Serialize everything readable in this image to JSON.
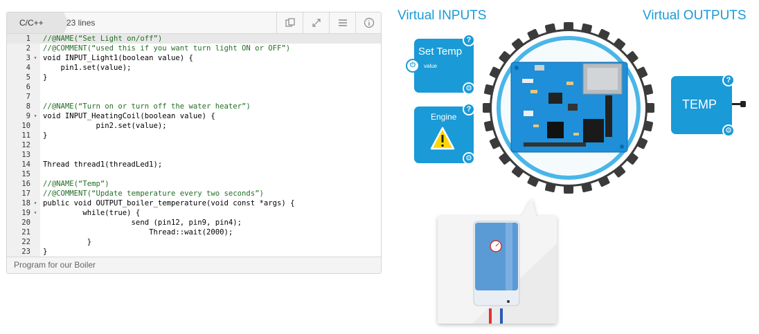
{
  "editor": {
    "language": "C/C++",
    "lines_count": "23 lines",
    "footer": "Program for our Boiler",
    "tools": [
      "copy-icon",
      "expand-icon",
      "menu-icon",
      "info-icon"
    ],
    "lines": [
      {
        "n": "1",
        "fold": "",
        "text": "//@NAME(“Set Light on/off”)",
        "cls": "t-c"
      },
      {
        "n": "2",
        "fold": "",
        "text": "//@COMMENT(“used this if you want turn light ON or OFF”)",
        "cls": "t-c"
      },
      {
        "n": "3",
        "fold": "▾",
        "text": "void INPUT_Light1(boolean value) {",
        "cls": "t-p"
      },
      {
        "n": "4",
        "fold": "",
        "text": "    pin1.set(value);",
        "cls": "t-p"
      },
      {
        "n": "5",
        "fold": "",
        "text": "}",
        "cls": "t-p"
      },
      {
        "n": "6",
        "fold": "",
        "text": "",
        "cls": "t-p"
      },
      {
        "n": "7",
        "fold": "",
        "text": "",
        "cls": "t-p"
      },
      {
        "n": "8",
        "fold": "",
        "text": "//@NAME(“Turn on or turn off the water heater”)",
        "cls": "t-c"
      },
      {
        "n": "9",
        "fold": "▾",
        "text": "void INPUT_HeatingCoil(boolean value) {",
        "cls": "t-p"
      },
      {
        "n": "10",
        "fold": "",
        "text": "            pin2.set(value);",
        "cls": "t-p"
      },
      {
        "n": "11",
        "fold": "",
        "text": "}",
        "cls": "t-p"
      },
      {
        "n": "12",
        "fold": "",
        "text": "",
        "cls": "t-p"
      },
      {
        "n": "13",
        "fold": "",
        "text": "",
        "cls": "t-p"
      },
      {
        "n": "14",
        "fold": "",
        "text": "Thread thread1(threadLed1);",
        "cls": "t-p"
      },
      {
        "n": "15",
        "fold": "",
        "text": "",
        "cls": "t-p"
      },
      {
        "n": "16",
        "fold": "",
        "text": "//@NAME(“Temp”)",
        "cls": "t-c"
      },
      {
        "n": "17",
        "fold": "",
        "text": "//@COMMENT(“Update temperature every two seconds”)",
        "cls": "t-c"
      },
      {
        "n": "18",
        "fold": "▾",
        "text": "public void OUTPUT_boiler_temperature(void const *args) {",
        "cls": "t-p"
      },
      {
        "n": "19",
        "fold": "▾",
        "text": "         while(true) {",
        "cls": "t-p"
      },
      {
        "n": "20",
        "fold": "",
        "text": "                    send (pin12, pin9, pin4);",
        "cls": "t-p"
      },
      {
        "n": "21",
        "fold": "",
        "text": "                        Thread::wait(2000);",
        "cls": "t-p"
      },
      {
        "n": "22",
        "fold": "",
        "text": "          }",
        "cls": "t-p"
      },
      {
        "n": "23",
        "fold": "",
        "text": "}",
        "cls": "t-p"
      }
    ]
  },
  "diagram": {
    "inputs_heading": "Virtual INPUTS",
    "outputs_heading": "Virtual OUTPUTS",
    "set_temp": {
      "title": "Set Temp",
      "sub": "value"
    },
    "engine": {
      "title": "Engine"
    },
    "temp": {
      "title": "TEMP"
    },
    "help_glyph": "?",
    "colors": {
      "accent": "#1a9ad6",
      "board": "#1e8fd8",
      "heater": "#5b9bd5"
    }
  }
}
